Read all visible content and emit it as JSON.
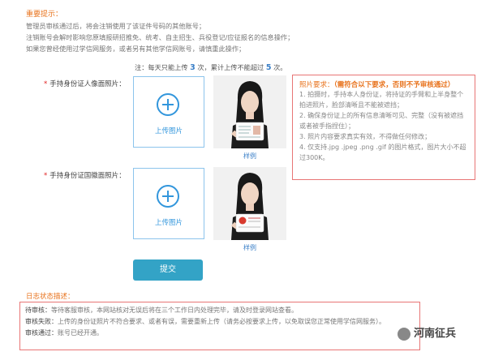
{
  "notice": {
    "title": "重要提示：",
    "lines": [
      "管理员审核通过后，将会注销使用了该证件号码的其他账号；",
      "注销账号会解时影响您原填报研招推免、统考、自主招生、兵役登记/应征报名的信息操作；",
      "如果您曾经使用过学信网服务，或者另有其他学信网账号，请慎重此操作；"
    ]
  },
  "limit": {
    "prefix": "注：每天只能上传",
    "daily": "3",
    "mid": "次，累计上传不能超过",
    "total": "5",
    "suffix": "次。"
  },
  "upload_front": {
    "label": "手持身份证人像面照片：",
    "button_text": "上传图片",
    "sample_label": "样例"
  },
  "upload_back": {
    "label": "手持身份证国徽面照片：",
    "button_text": "上传图片",
    "sample_label": "样例"
  },
  "requirements": {
    "title": "照片要求：",
    "title_note": "（需符合以下要求，否则不予审核通过）",
    "items": [
      "1. 拍摄时，手持本人身份证，将持证的手臂和上半身整个拍进照片，脸部清晰且不能被遮挡；",
      "2. 确保身份证上的所有信息清晰可见、完整（没有被遮挡或者被手指捏住）；",
      "3. 照片内容要求真实有效，不得做任何修改；",
      "4. 仅支持.jpg .jpeg .png .gif 的图片格式，图片大小不超过300K。"
    ]
  },
  "submit_label": "提交",
  "log": {
    "title": "日志状态描述：",
    "rows": [
      {
        "key": "待审核：",
        "text": "等待客服审核，本网站核对无误后将在三个工作日内处理完毕，请及时登录网站查看。"
      },
      {
        "key": "审核失败：",
        "text": "上传的身份证照片不符合要求、或者有误，需要重新上传（请务必按要求上传，以免取误您正常使用学信网服务）。"
      },
      {
        "key": "审核通过：",
        "text": "账号已经开通。"
      }
    ]
  },
  "watermark": "河南征兵",
  "colors": {
    "accent": "#e8731d",
    "primary": "#3296dc",
    "button": "#33a3c6",
    "border_red": "#e87575"
  }
}
